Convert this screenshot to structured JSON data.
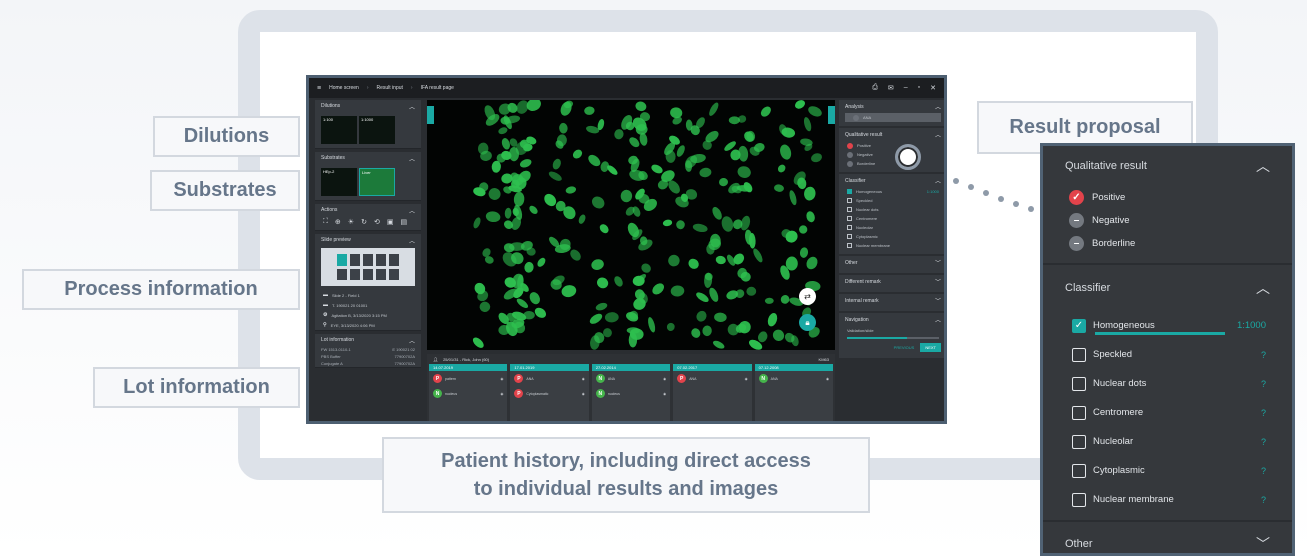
{
  "callouts": {
    "dilutions": "Dilutions",
    "substrates": "Substrates",
    "process_information": "Process information",
    "lot_information": "Lot information",
    "result_proposal": "Result proposal",
    "patient_history_line1": "Patient history, including direct access",
    "patient_history_line2": "to individual results and images"
  },
  "app": {
    "breadcrumb": [
      "Home screen",
      "Result input",
      "IFA result page"
    ],
    "left": {
      "dilutions_title": "Dilutions",
      "dilution_thumbs": [
        "1:100",
        "1:1000"
      ],
      "substrates_title": "Substrates",
      "substrate_thumbs": [
        "HEp-2",
        "Liver"
      ],
      "actions_title": "Actions",
      "slide_title": "Slide preview",
      "process_rows": [
        "Slide 2 - Field 1",
        "T. 190021 20 01001",
        "Agitation B, 3/13/2020 3:15 PM",
        "EYE, 3/13/2020 4:06 PM"
      ],
      "lot_title": "Lot information",
      "lot_rows": [
        [
          "FW 1513-0110-1",
          "E 190021 02"
        ],
        [
          "PBS Buffer",
          "77900702A"
        ],
        [
          "Conjugate A",
          "77900702A"
        ]
      ]
    },
    "right": {
      "analysis_title": "Analysis",
      "analysis_item": "ANA",
      "qual_title": "Qualitative result",
      "qual_items": [
        "Positive",
        "Negative",
        "Borderline"
      ],
      "classifier_title": "Classifier",
      "classifier_items": [
        "Homogeneous",
        "Speckled",
        "Nuclear dots",
        "Centromere",
        "Nucleolar",
        "Cytoplasmic",
        "Nuclear membrane"
      ],
      "classifier_titer": "1:1000",
      "other_title": "Other",
      "different_remark": "Different remark",
      "internal_remark": "Internal remark",
      "navigation_title": "Navigation",
      "navigation_sub": "Validation/slide",
      "previous_label": "PREVIOUS",
      "next_label": "NEXT"
    },
    "history": {
      "patient": "25/01/31 - Rick, John (60)",
      "patient_id": "KM63",
      "cards": [
        {
          "date": "14.07.2019",
          "rows": [
            {
              "badge": "P",
              "label": "pattern"
            },
            {
              "badge": "N",
              "label": "nucleus"
            }
          ]
        },
        {
          "date": "17.01.2019",
          "rows": [
            {
              "badge": "P",
              "label": "ANA"
            },
            {
              "badge": "P",
              "label": "Cytoplasmatic"
            }
          ]
        },
        {
          "date": "27.02.2014",
          "rows": [
            {
              "badge": "N",
              "label": "ANA"
            },
            {
              "badge": "N",
              "label": "nucleus"
            }
          ]
        },
        {
          "date": "07.02.2017",
          "rows": [
            {
              "badge": "P",
              "label": "ANA"
            }
          ]
        },
        {
          "date": "07.12.2008",
          "rows": [
            {
              "badge": "N",
              "label": "ANA"
            }
          ]
        }
      ]
    }
  },
  "zoom": {
    "qual_title": "Qualitative result",
    "qual_items": [
      "Positive",
      "Negative",
      "Borderline"
    ],
    "classifier_title": "Classifier",
    "classifier_items": [
      "Homogeneous",
      "Speckled",
      "Nuclear dots",
      "Centromere",
      "Nucleolar",
      "Cytoplasmic",
      "Nuclear membrane"
    ],
    "classifier_titer": "1:1000",
    "question_mark": "?",
    "other_title": "Other"
  },
  "colors": {
    "accent": "#1aa9a4",
    "positive": "#e2434b",
    "negative": "#45b44b",
    "cell_green": "#2ec04f"
  }
}
